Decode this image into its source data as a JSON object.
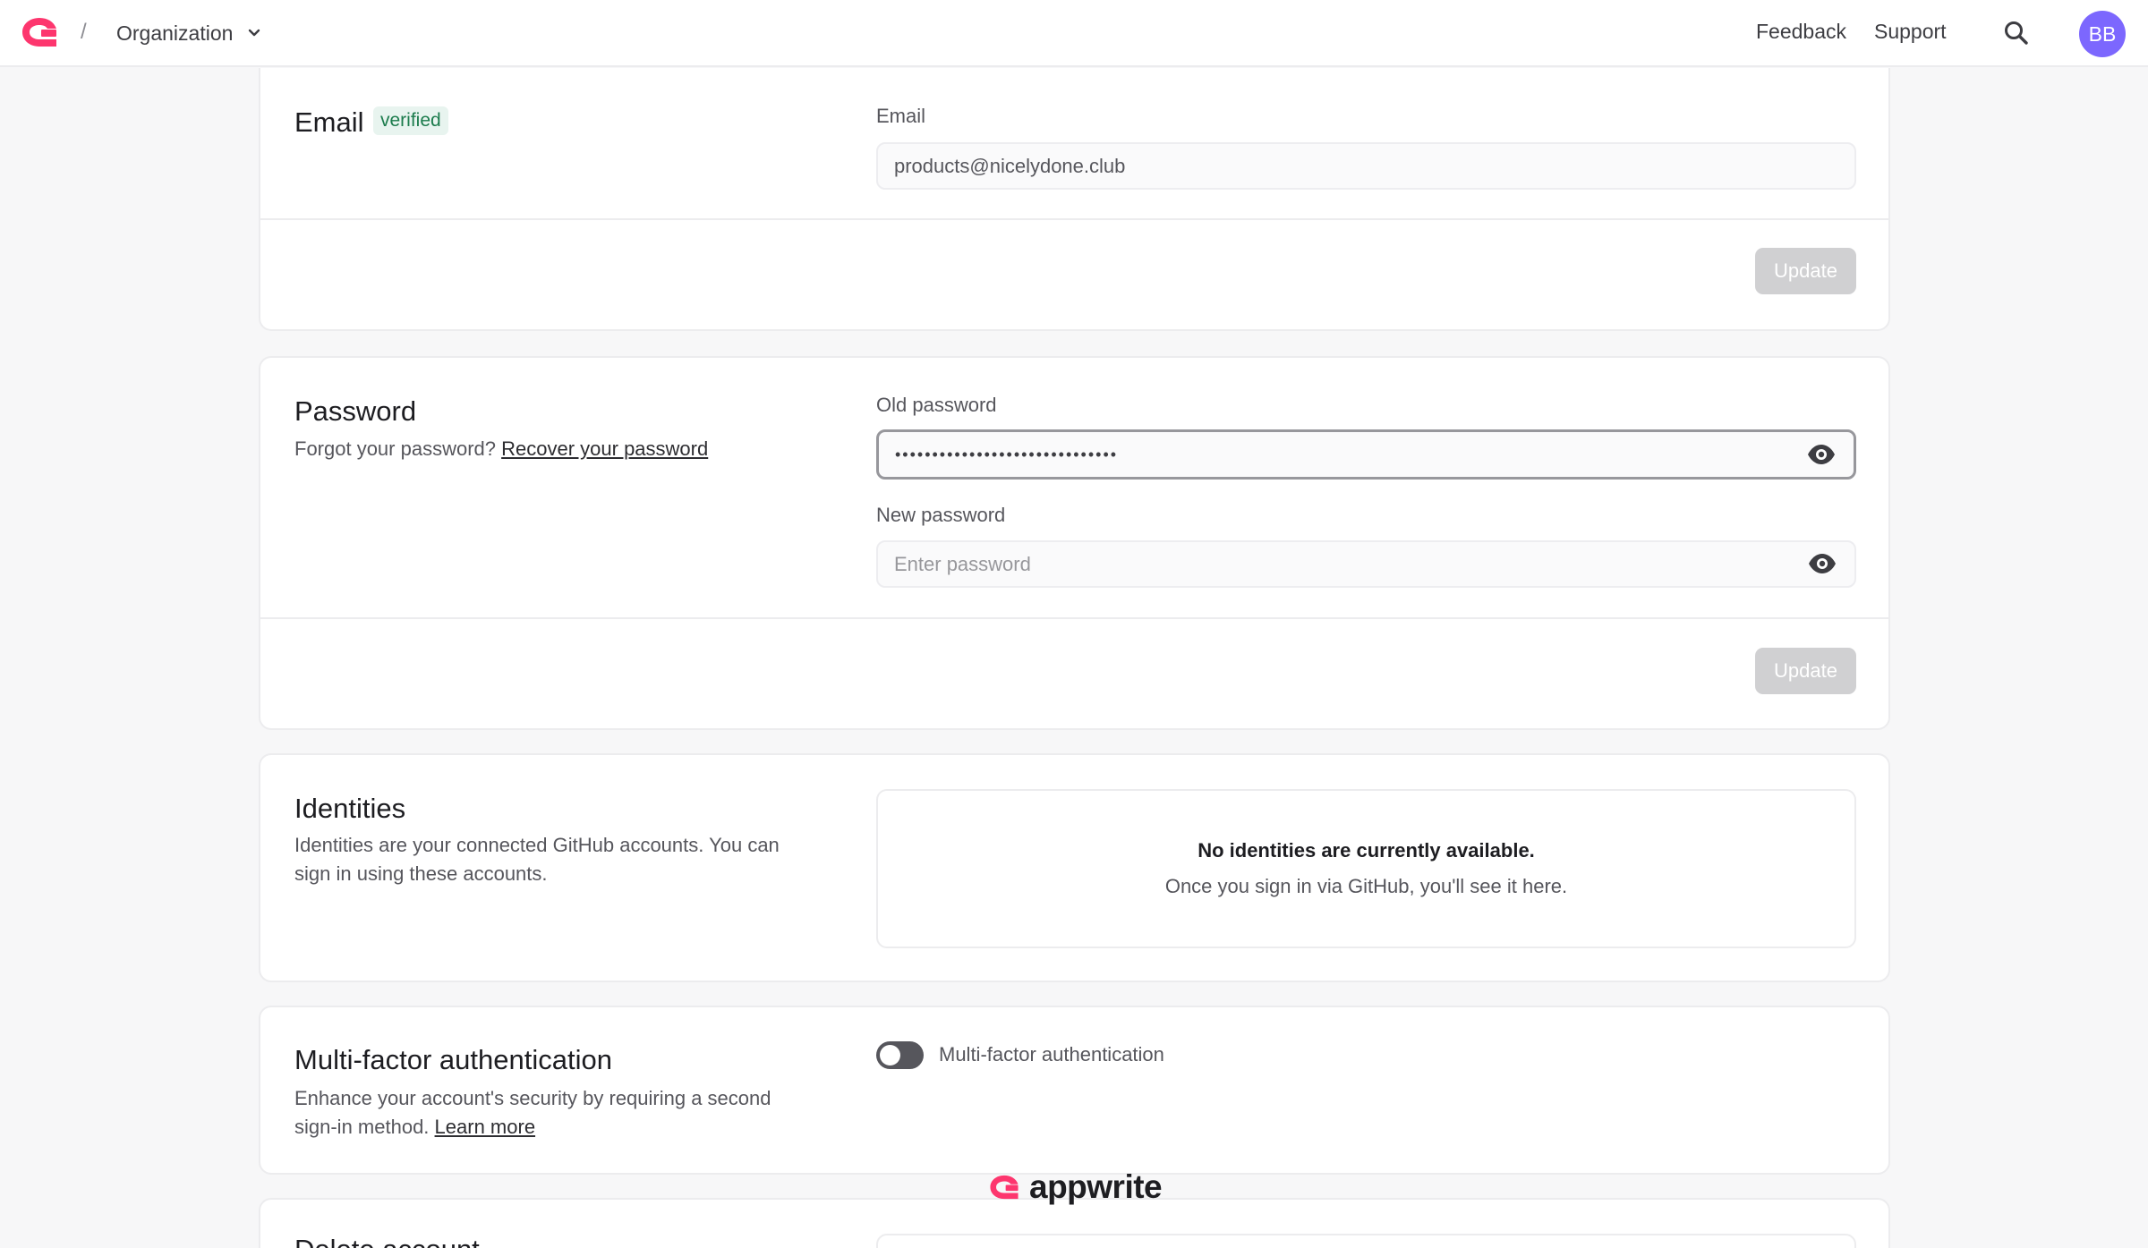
{
  "header": {
    "breadcrumb_separator": "/",
    "organization_label": "Organization",
    "feedback_label": "Feedback",
    "support_label": "Support",
    "avatar_initials": "BB",
    "brand_color": "#fd366e",
    "avatar_color": "#7c67fe"
  },
  "email_card": {
    "title": "Email",
    "badge": "verified",
    "field_label": "Email",
    "field_value": "products@nicelydone.club",
    "update_label": "Update"
  },
  "password_card": {
    "title": "Password",
    "forgot_text": "Forgot your password?",
    "recover_link": "Recover your password",
    "old_label": "Old password",
    "old_value_masked": "••••••••••••••••••••••••••••••",
    "new_label": "New password",
    "new_placeholder": "Enter password",
    "update_label": "Update"
  },
  "identities_card": {
    "title": "Identities",
    "description": "Identities are your connected GitHub accounts. You can sign in using these accounts.",
    "empty_title": "No identities are currently available.",
    "empty_subtitle": "Once you sign in via GitHub, you'll see it here."
  },
  "mfa_card": {
    "title": "Multi-factor authentication",
    "description": "Enhance your account's security by requiring a second sign-in method.",
    "learn_more": "Learn more",
    "toggle_label": "Multi-factor authentication",
    "toggle_on": false
  },
  "delete_card": {
    "title": "Delete account"
  },
  "watermark": {
    "text": "appwrite"
  }
}
